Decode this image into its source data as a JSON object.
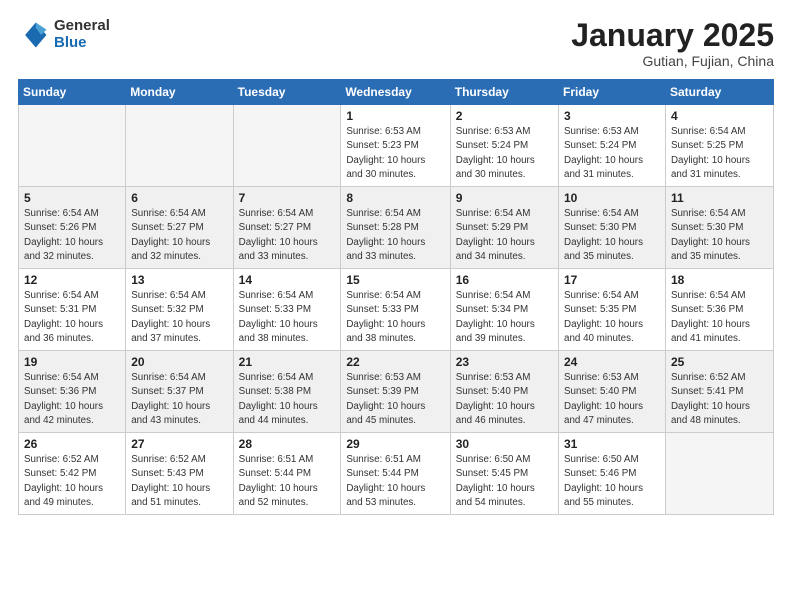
{
  "header": {
    "logo_general": "General",
    "logo_blue": "Blue",
    "month_title": "January 2025",
    "subtitle": "Gutian, Fujian, China"
  },
  "weekdays": [
    "Sunday",
    "Monday",
    "Tuesday",
    "Wednesday",
    "Thursday",
    "Friday",
    "Saturday"
  ],
  "weeks": [
    [
      {
        "day": "",
        "info": ""
      },
      {
        "day": "",
        "info": ""
      },
      {
        "day": "",
        "info": ""
      },
      {
        "day": "1",
        "info": "Sunrise: 6:53 AM\nSunset: 5:23 PM\nDaylight: 10 hours\nand 30 minutes."
      },
      {
        "day": "2",
        "info": "Sunrise: 6:53 AM\nSunset: 5:24 PM\nDaylight: 10 hours\nand 30 minutes."
      },
      {
        "day": "3",
        "info": "Sunrise: 6:53 AM\nSunset: 5:24 PM\nDaylight: 10 hours\nand 31 minutes."
      },
      {
        "day": "4",
        "info": "Sunrise: 6:54 AM\nSunset: 5:25 PM\nDaylight: 10 hours\nand 31 minutes."
      }
    ],
    [
      {
        "day": "5",
        "info": "Sunrise: 6:54 AM\nSunset: 5:26 PM\nDaylight: 10 hours\nand 32 minutes."
      },
      {
        "day": "6",
        "info": "Sunrise: 6:54 AM\nSunset: 5:27 PM\nDaylight: 10 hours\nand 32 minutes."
      },
      {
        "day": "7",
        "info": "Sunrise: 6:54 AM\nSunset: 5:27 PM\nDaylight: 10 hours\nand 33 minutes."
      },
      {
        "day": "8",
        "info": "Sunrise: 6:54 AM\nSunset: 5:28 PM\nDaylight: 10 hours\nand 33 minutes."
      },
      {
        "day": "9",
        "info": "Sunrise: 6:54 AM\nSunset: 5:29 PM\nDaylight: 10 hours\nand 34 minutes."
      },
      {
        "day": "10",
        "info": "Sunrise: 6:54 AM\nSunset: 5:30 PM\nDaylight: 10 hours\nand 35 minutes."
      },
      {
        "day": "11",
        "info": "Sunrise: 6:54 AM\nSunset: 5:30 PM\nDaylight: 10 hours\nand 35 minutes."
      }
    ],
    [
      {
        "day": "12",
        "info": "Sunrise: 6:54 AM\nSunset: 5:31 PM\nDaylight: 10 hours\nand 36 minutes."
      },
      {
        "day": "13",
        "info": "Sunrise: 6:54 AM\nSunset: 5:32 PM\nDaylight: 10 hours\nand 37 minutes."
      },
      {
        "day": "14",
        "info": "Sunrise: 6:54 AM\nSunset: 5:33 PM\nDaylight: 10 hours\nand 38 minutes."
      },
      {
        "day": "15",
        "info": "Sunrise: 6:54 AM\nSunset: 5:33 PM\nDaylight: 10 hours\nand 38 minutes."
      },
      {
        "day": "16",
        "info": "Sunrise: 6:54 AM\nSunset: 5:34 PM\nDaylight: 10 hours\nand 39 minutes."
      },
      {
        "day": "17",
        "info": "Sunrise: 6:54 AM\nSunset: 5:35 PM\nDaylight: 10 hours\nand 40 minutes."
      },
      {
        "day": "18",
        "info": "Sunrise: 6:54 AM\nSunset: 5:36 PM\nDaylight: 10 hours\nand 41 minutes."
      }
    ],
    [
      {
        "day": "19",
        "info": "Sunrise: 6:54 AM\nSunset: 5:36 PM\nDaylight: 10 hours\nand 42 minutes."
      },
      {
        "day": "20",
        "info": "Sunrise: 6:54 AM\nSunset: 5:37 PM\nDaylight: 10 hours\nand 43 minutes."
      },
      {
        "day": "21",
        "info": "Sunrise: 6:54 AM\nSunset: 5:38 PM\nDaylight: 10 hours\nand 44 minutes."
      },
      {
        "day": "22",
        "info": "Sunrise: 6:53 AM\nSunset: 5:39 PM\nDaylight: 10 hours\nand 45 minutes."
      },
      {
        "day": "23",
        "info": "Sunrise: 6:53 AM\nSunset: 5:40 PM\nDaylight: 10 hours\nand 46 minutes."
      },
      {
        "day": "24",
        "info": "Sunrise: 6:53 AM\nSunset: 5:40 PM\nDaylight: 10 hours\nand 47 minutes."
      },
      {
        "day": "25",
        "info": "Sunrise: 6:52 AM\nSunset: 5:41 PM\nDaylight: 10 hours\nand 48 minutes."
      }
    ],
    [
      {
        "day": "26",
        "info": "Sunrise: 6:52 AM\nSunset: 5:42 PM\nDaylight: 10 hours\nand 49 minutes."
      },
      {
        "day": "27",
        "info": "Sunrise: 6:52 AM\nSunset: 5:43 PM\nDaylight: 10 hours\nand 51 minutes."
      },
      {
        "day": "28",
        "info": "Sunrise: 6:51 AM\nSunset: 5:44 PM\nDaylight: 10 hours\nand 52 minutes."
      },
      {
        "day": "29",
        "info": "Sunrise: 6:51 AM\nSunset: 5:44 PM\nDaylight: 10 hours\nand 53 minutes."
      },
      {
        "day": "30",
        "info": "Sunrise: 6:50 AM\nSunset: 5:45 PM\nDaylight: 10 hours\nand 54 minutes."
      },
      {
        "day": "31",
        "info": "Sunrise: 6:50 AM\nSunset: 5:46 PM\nDaylight: 10 hours\nand 55 minutes."
      },
      {
        "day": "",
        "info": ""
      }
    ]
  ]
}
